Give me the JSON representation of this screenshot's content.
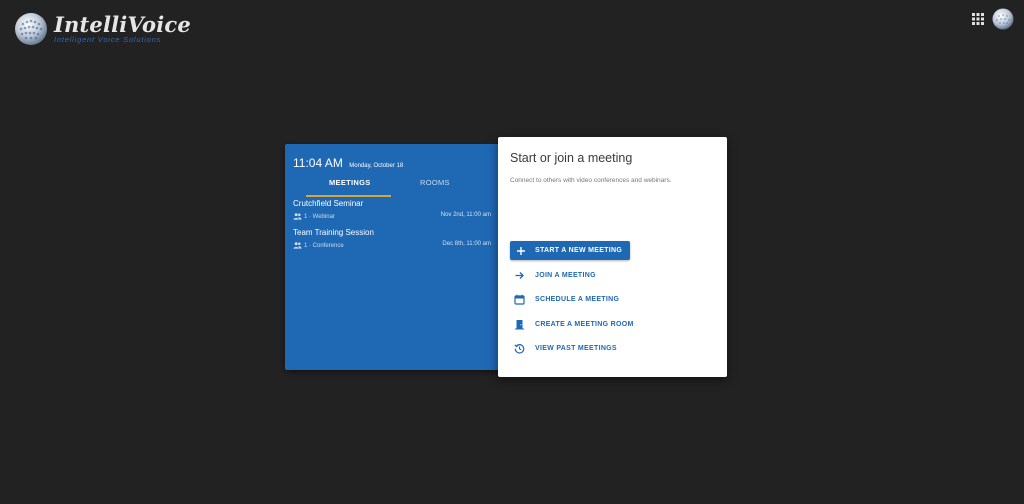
{
  "header": {
    "logo_name": "IntelliVoice",
    "logo_tagline": "Intelligent Voice Solutions",
    "icons": [
      "globe-logo-icon",
      "apps-grid-icon",
      "avatar-globe-icon"
    ]
  },
  "colors": {
    "background": "#222222",
    "panel_blue": "#1f68b4",
    "tab_underline": "#d6a53b",
    "card_white": "#ffffff"
  },
  "clock": {
    "time": "11:04 AM",
    "date": "Monday, October 18"
  },
  "tabs": [
    {
      "label": "MEETINGS",
      "active": true
    },
    {
      "label": "ROOMS",
      "active": false
    }
  ],
  "meetings": [
    {
      "title": "Crutchfield Seminar",
      "info": "1 · Webinar",
      "date": "Nov 2nd, 11:00 am"
    },
    {
      "title": "Team Training Session",
      "info": "1 · Conference",
      "date": "Dec 8th, 11:00 am"
    }
  ],
  "card": {
    "title": "Start or join a meeting",
    "subtitle": "Connect to others with video conferences and webinars.",
    "primary_action": {
      "label": "START A NEW MEETING",
      "icon": "plus-icon"
    },
    "actions": [
      {
        "label": "JOIN A MEETING",
        "icon": "arrow-right-icon"
      },
      {
        "label": "SCHEDULE A MEETING",
        "icon": "calendar-icon"
      },
      {
        "label": "CREATE A MEETING ROOM",
        "icon": "door-icon"
      },
      {
        "label": "VIEW PAST MEETINGS",
        "icon": "history-icon"
      }
    ]
  }
}
